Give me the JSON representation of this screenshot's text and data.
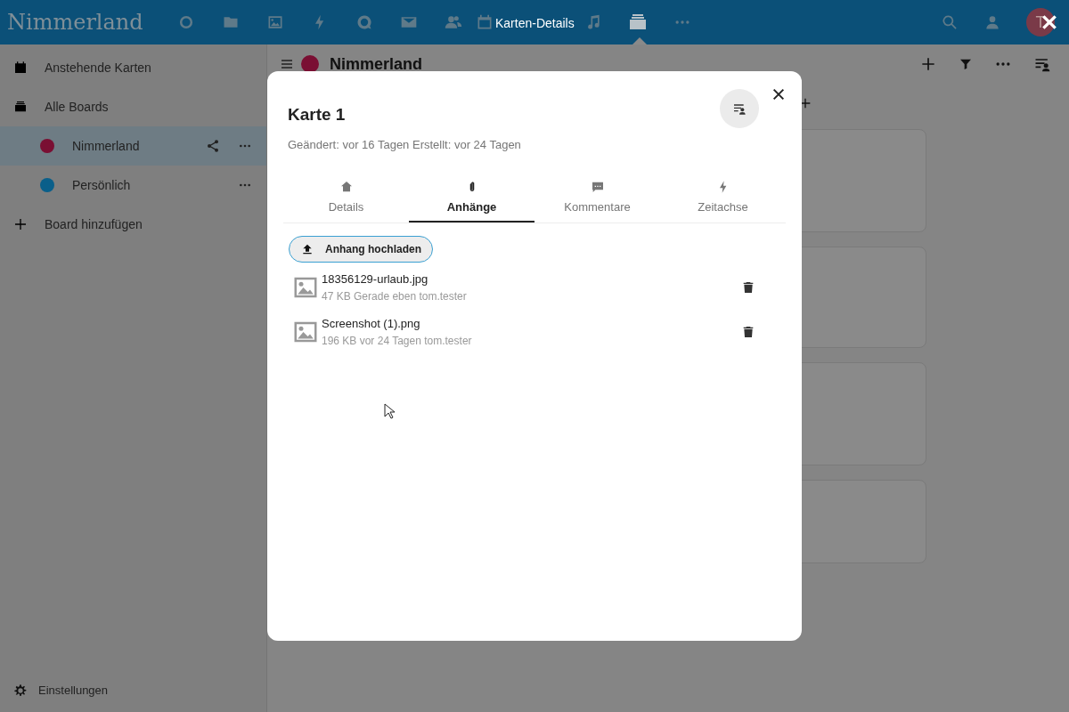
{
  "header": {
    "logo": "Nimmerland",
    "title": "Karten-Details",
    "apps": [
      {
        "kind": "circle",
        "selected": false
      },
      {
        "kind": "folder",
        "selected": false
      },
      {
        "kind": "image",
        "selected": false
      },
      {
        "kind": "bolt",
        "selected": false
      },
      {
        "kind": "chat",
        "selected": false
      },
      {
        "kind": "mail",
        "selected": false
      },
      {
        "kind": "contacts",
        "selected": false
      },
      {
        "kind": "calendar",
        "selected": false
      },
      {
        "kind": "music",
        "selected": false
      },
      {
        "kind": "deck",
        "selected": true
      },
      {
        "kind": "more",
        "selected": false
      }
    ],
    "avatar": "T"
  },
  "sidebar": {
    "items": [
      {
        "kind": "calendar",
        "label": "Anstehende Karten",
        "selected": false
      },
      {
        "kind": "deck",
        "label": "Alle Boards",
        "selected": false
      },
      {
        "kind": "board",
        "label": "Nimmerland",
        "color": "#7a0f33",
        "shared": true,
        "selected": true
      },
      {
        "kind": "board",
        "label": "Persönlich",
        "color": "#0a5f8a",
        "shared": false,
        "selected": false
      },
      {
        "kind": "add",
        "label": "Board hinzufügen",
        "selected": false
      }
    ],
    "settings": "Einstellungen"
  },
  "board": {
    "title": "Nimmerland",
    "color": "#7a0f33"
  },
  "modal": {
    "title": "Karte 1",
    "meta": "Geändert: vor 16 Tagen Erstellt: vor 24 Tagen",
    "tabs": [
      {
        "kind": "home",
        "label": "Details",
        "selected": false
      },
      {
        "kind": "clip",
        "label": "Anhänge",
        "selected": true
      },
      {
        "kind": "comment",
        "label": "Kommentare",
        "selected": false
      },
      {
        "kind": "bolt",
        "label": "Zeitachse",
        "selected": false
      }
    ],
    "upload": "Anhang hochladen",
    "attachments": [
      {
        "name": "18356129-urlaub.jpg",
        "info": "47 KB Gerade eben tom.tester"
      },
      {
        "name": "Screenshot (1).png",
        "info": "196 KB vor 24 Tagen tom.tester"
      }
    ]
  }
}
